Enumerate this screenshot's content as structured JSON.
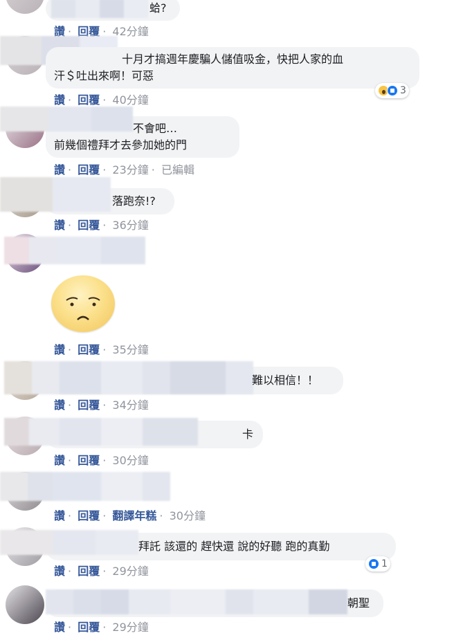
{
  "actions": {
    "like": "讚",
    "reply": "回覆",
    "translate": "翻譯年糕",
    "edited": "已編輯"
  },
  "comments": [
    {
      "text_lines": [
        "蛤?"
      ],
      "time": "42分鐘"
    },
    {
      "text_lines": [
        "十月才搞週年慶騙人儲值吸金，快把人家的血",
        "汗＄吐出來啊！可惡"
      ],
      "time": "40分鐘",
      "reaction": {
        "icons": [
          "wow-icon",
          "like-icon"
        ],
        "count": "3"
      }
    },
    {
      "text_lines": [
        "不會吧…",
        "前幾個禮拜才去參加她的門"
      ],
      "time": "23分鐘"
    },
    {
      "text_lines": [
        "落跑奈!?"
      ],
      "time": "36分鐘"
    },
    {
      "sticker": "worried-face-sticker",
      "time": "35分鐘"
    },
    {
      "text_lines": [
        "難以相信！！"
      ],
      "time": "34分鐘"
    },
    {
      "text_lines": [
        "卡"
      ],
      "time": "30分鐘"
    },
    {
      "text_lines": [],
      "time": "30分鐘"
    },
    {
      "text_lines": [
        "拜託 該還的 趕快還 說的好聽 跑的真勤"
      ],
      "time": "29分鐘",
      "reaction": {
        "icons": [
          "like-icon"
        ],
        "count": "1"
      }
    },
    {
      "text_lines": [
        "朝聖"
      ],
      "time": "29分鐘"
    }
  ],
  "colors": {
    "link": "#365899",
    "meta": "#90949c",
    "bubble": "#f2f3f5"
  }
}
